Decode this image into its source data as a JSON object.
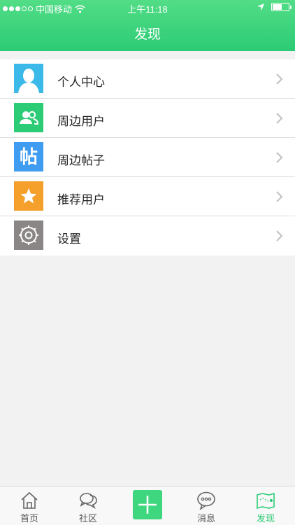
{
  "status_bar": {
    "carrier": "中国移动",
    "time": "上午11:18"
  },
  "header": {
    "title": "发现"
  },
  "menu": [
    {
      "label": "个人中心",
      "icon": "person-icon",
      "color": "#3bb9e8"
    },
    {
      "label": "周边用户",
      "icon": "users-icon",
      "color": "#2ccb75"
    },
    {
      "label": "周边帖子",
      "icon": "post-icon",
      "color": "#3f9cf0",
      "icon_text": "帖"
    },
    {
      "label": "推荐用户",
      "icon": "star-icon",
      "color": "#f6a02c"
    },
    {
      "label": "设置",
      "icon": "gear-icon",
      "color": "#8a8685"
    }
  ],
  "tabbar": {
    "tabs": [
      {
        "label": "首页",
        "icon": "home-icon"
      },
      {
        "label": "社区",
        "icon": "community-icon"
      },
      {
        "label": "",
        "icon": "plus-icon"
      },
      {
        "label": "消息",
        "icon": "message-icon"
      },
      {
        "label": "发现",
        "icon": "discover-map-icon",
        "active": true
      }
    ]
  },
  "colors": {
    "accent": "#2ccb75",
    "background": "#f2f2f2"
  }
}
